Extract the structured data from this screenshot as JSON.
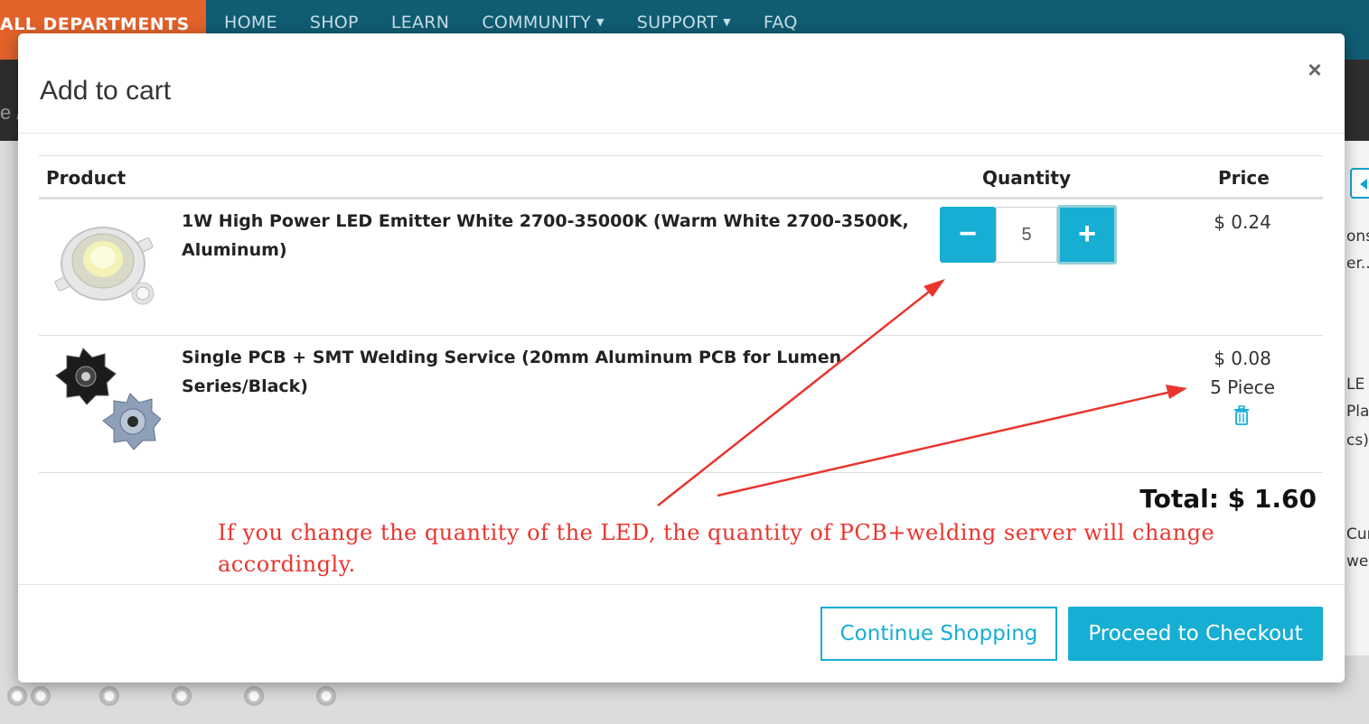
{
  "background": {
    "departments_label": "ALL DEPARTMENTS",
    "nav": [
      {
        "label": "HOME",
        "has_dropdown": false
      },
      {
        "label": "SHOP",
        "has_dropdown": false
      },
      {
        "label": "LEARN",
        "has_dropdown": false
      },
      {
        "label": "COMMUNITY",
        "has_dropdown": true
      },
      {
        "label": "SUPPORT",
        "has_dropdown": true
      },
      {
        "label": "FAQ",
        "has_dropdown": false
      }
    ],
    "breadcrumb_fragment": "e /",
    "side_fragments": [
      "ons",
      "er...",
      "LE",
      "Plat",
      "cs)",
      "Cur",
      "wer"
    ]
  },
  "modal": {
    "title": "Add to cart",
    "close_label": "×",
    "columns": {
      "product": "Product",
      "quantity": "Quantity",
      "price": "Price"
    },
    "items": [
      {
        "name": "1W High Power LED Emitter White 2700-35000K (Warm White 2700-3500K, Aluminum)",
        "quantity": "5",
        "price": "$ 0.24",
        "image_icon": "led-emitter"
      },
      {
        "name": "Single PCB + SMT Welding Service (20mm Aluminum PCB for Lumen Series/Black)",
        "price": "$ 0.08",
        "quantity_text": "5 Piece",
        "image_icon": "star-pcb"
      }
    ],
    "total": "Total: $ 1.60",
    "annotation": "If you change the quantity of the LED, the quantity of PCB+welding server will change accordingly.",
    "buttons": {
      "continue": "Continue Shopping",
      "checkout": "Proceed to Checkout"
    },
    "qty_minus": "−",
    "qty_plus": "+"
  },
  "colors": {
    "accent": "#17aed3",
    "annotation": "#e8362f",
    "nav_bg": "#0f5c73",
    "departments_bg": "#e2622a"
  }
}
